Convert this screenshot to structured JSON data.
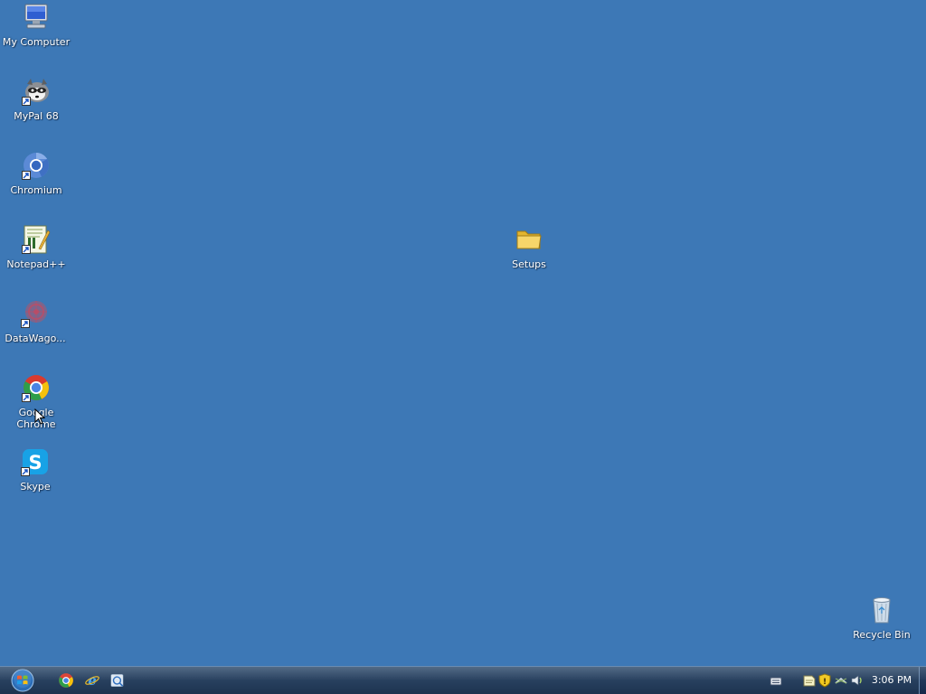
{
  "desktop": {
    "icons": [
      {
        "label": "My Computer"
      },
      {
        "label": "MyPal 68"
      },
      {
        "label": "Chromium"
      },
      {
        "label": "Notepad++"
      },
      {
        "label": "DataWago..."
      },
      {
        "label": "Google Chrome"
      },
      {
        "label": "Skype"
      },
      {
        "label": "Setups"
      },
      {
        "label": "Recycle Bin"
      }
    ]
  },
  "taskbar": {
    "start_icon": "windows-orb-icon",
    "quick_launch": [
      "chrome-icon",
      "internet-explorer-icon",
      "explorer-icon"
    ],
    "tray_icons": [
      "keyboard-icon",
      "notes-icon",
      "security-shield-icon",
      "network-icon",
      "volume-icon"
    ],
    "clock": "3:06 PM"
  },
  "colors": {
    "desktop_background": "#3d78b6",
    "taskbar": "#2a4362",
    "label_text": "#ffffff"
  }
}
